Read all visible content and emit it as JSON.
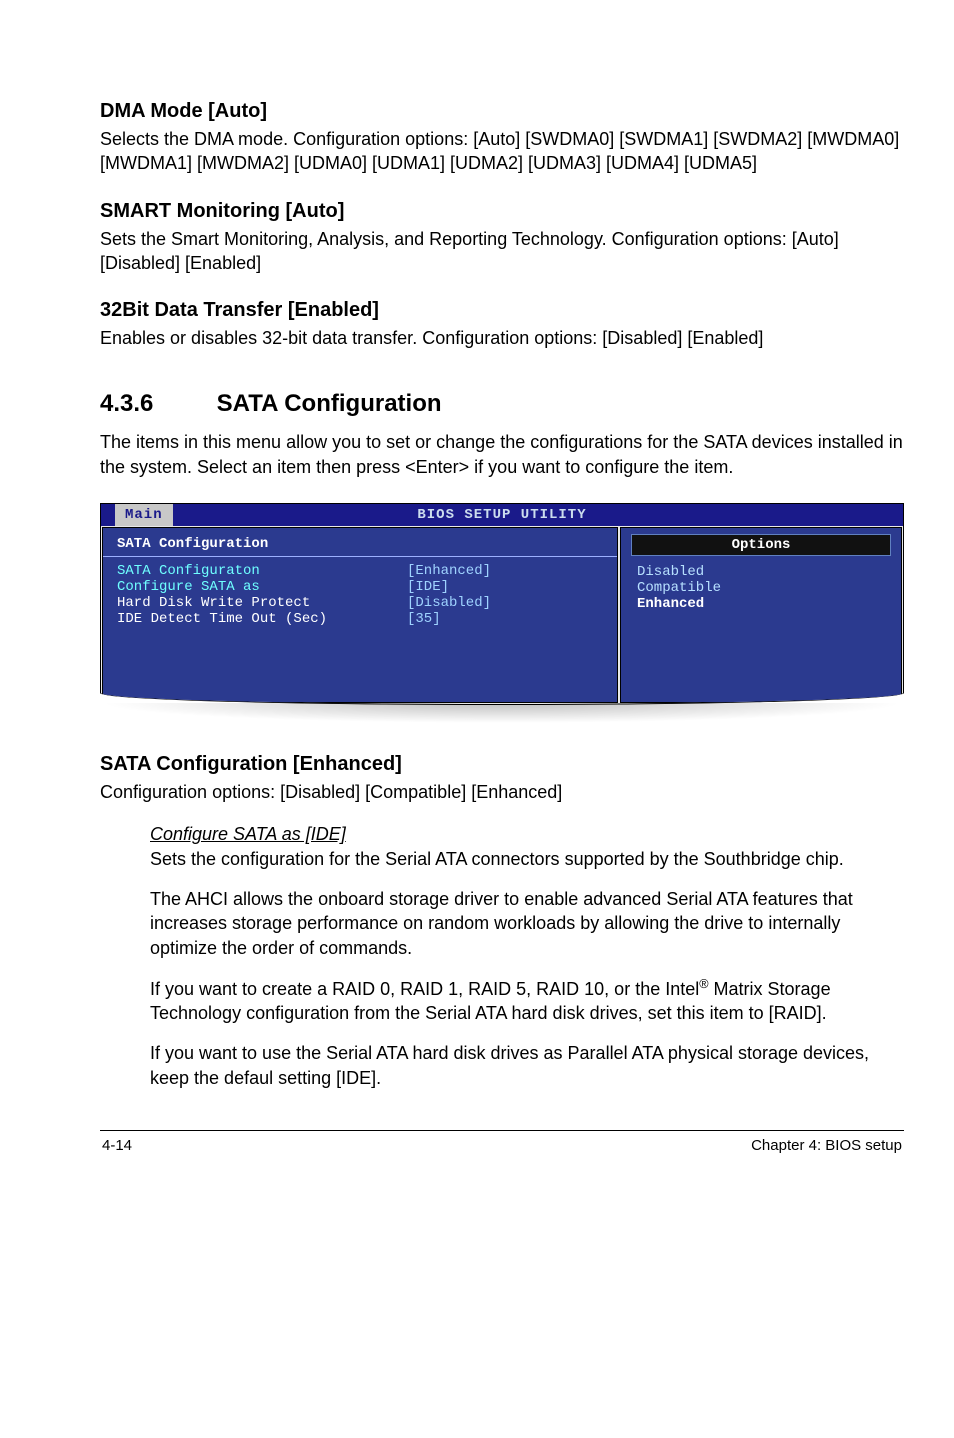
{
  "dma": {
    "title": "DMA Mode [Auto]",
    "body": "Selects the DMA mode. Configuration options: [Auto] [SWDMA0] [SWDMA1] [SWDMA2] [MWDMA0] [MWDMA1] [MWDMA2] [UDMA0] [UDMA1] [UDMA2] [UDMA3] [UDMA4] [UDMA5]"
  },
  "smart": {
    "title": "SMART Monitoring [Auto]",
    "body": "Sets the Smart Monitoring, Analysis, and Reporting Technology. Configuration options: [Auto] [Disabled] [Enabled]"
  },
  "bit32": {
    "title": "32Bit Data Transfer [Enabled]",
    "body": "Enables or disables 32-bit data transfer. Configuration options: [Disabled] [Enabled]"
  },
  "section": {
    "num": "4.3.6",
    "title": "SATA Configuration",
    "intro": "The items in this menu allow you to set or change the configurations for the SATA devices installed in the system. Select an item then press <Enter> if you want to configure the item."
  },
  "bios": {
    "header": "BIOS SETUP UTILITY",
    "tab": "Main",
    "left_title": "SATA Configuration",
    "rows": [
      {
        "k": "SATA Configuraton",
        "v": "[Enhanced]",
        "cls": "cyan"
      },
      {
        "k": " Configure SATA as",
        "v": "[IDE]",
        "cls": "cyan"
      },
      {
        "k": "",
        "v": "",
        "cls": ""
      },
      {
        "k": "Hard Disk Write Protect",
        "v": "[Disabled]",
        "cls": "white"
      },
      {
        "k": "IDE Detect Time Out (Sec)",
        "v": "[35]",
        "cls": "white"
      }
    ],
    "options_label": "Options",
    "options": [
      "Disabled",
      "Compatible",
      "Enhanced"
    ],
    "selected": "Enhanced"
  },
  "sata_conf": {
    "title": "SATA Configuration [Enhanced]",
    "body": "Configuration options: [Disabled] [Compatible] [Enhanced]"
  },
  "ide": {
    "heading": "Configure SATA as [IDE]",
    "p1": "Sets the configuration for the Serial ATA connectors supported by the Southbridge chip.",
    "p2": "The AHCI allows the onboard storage driver to enable advanced Serial ATA features that increases storage performance on random workloads by allowing the drive to internally optimize the order of commands.",
    "p3a": "If you want to create a RAID 0, RAID 1,  RAID 5,  RAID 10, or the Intel",
    "p3b": " Matrix Storage Technology configuration from the Serial ATA hard disk drives, set this item to [RAID].",
    "p4": "If you want to use the Serial ATA hard disk drives as Parallel ATA physical storage devices, keep the defaul setting [IDE]."
  },
  "footer": {
    "left": "4-14",
    "right": "Chapter 4: BIOS setup"
  },
  "chart_data": {
    "type": "table",
    "title": "BIOS SETUP UTILITY — Main — SATA Configuration",
    "rows": [
      {
        "setting": "SATA Configuraton",
        "value": "Enhanced"
      },
      {
        "setting": "Configure SATA as",
        "value": "IDE"
      },
      {
        "setting": "Hard Disk Write Protect",
        "value": "Disabled"
      },
      {
        "setting": "IDE Detect Time Out (Sec)",
        "value": "35"
      }
    ],
    "options_panel": {
      "label": "Options",
      "items": [
        "Disabled",
        "Compatible",
        "Enhanced"
      ],
      "selected": "Enhanced"
    }
  }
}
